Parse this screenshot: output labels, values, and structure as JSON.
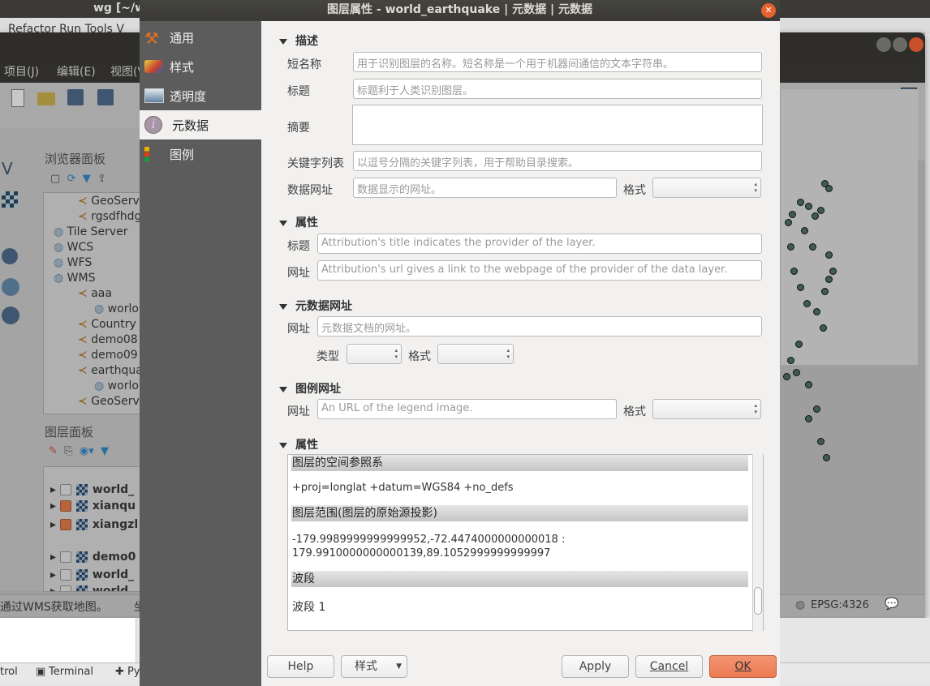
{
  "background": {
    "window_title": "wg [~/w",
    "ide_menu": "Refactor  Run  Tools  V",
    "qgis_menu": [
      "项目(J)",
      "编辑(E)",
      "视图(V"
    ],
    "browser_panel": {
      "title": "浏览器面板",
      "items": [
        {
          "label": "GeoServ",
          "indent": 2
        },
        {
          "label": "rgsdfhdg",
          "indent": 2
        },
        {
          "label": "Tile Server",
          "indent": 1
        },
        {
          "label": "WCS",
          "indent": 1
        },
        {
          "label": "WFS",
          "indent": 1
        },
        {
          "label": "WMS",
          "indent": 1
        },
        {
          "label": "aaa",
          "indent": 2
        },
        {
          "label": "worlo",
          "indent": 3
        },
        {
          "label": "Country",
          "indent": 2
        },
        {
          "label": "demo08",
          "indent": 2
        },
        {
          "label": "demo09",
          "indent": 2
        },
        {
          "label": "earthqua",
          "indent": 2
        },
        {
          "label": "worlo",
          "indent": 3
        },
        {
          "label": "GeoServ",
          "indent": 2
        }
      ]
    },
    "layers_panel": {
      "title": "图层面板",
      "layers": [
        {
          "label": "world_",
          "checked": false
        },
        {
          "label": "xianqu",
          "checked": true
        },
        {
          "label": "xiangzl",
          "checked": true
        },
        {
          "label": "demo0",
          "checked": false
        },
        {
          "label": "world_",
          "checked": false
        },
        {
          "label": "world",
          "checked": false
        }
      ]
    },
    "status_message": "通过WMS获取地图。",
    "status_coord_label": "坐",
    "crs": "EPSG:4326",
    "ide_tabs": [
      "trol",
      "Terminal",
      "Py"
    ]
  },
  "dialog": {
    "title": "图层属性 - world_earthquake | 元数据 | 元数据",
    "sidebar": [
      {
        "label": "通用",
        "icon": "tools-icon"
      },
      {
        "label": "样式",
        "icon": "paintbrush-icon"
      },
      {
        "label": "透明度",
        "icon": "transparency-icon"
      },
      {
        "label": "元数据",
        "icon": "info-icon",
        "selected": true
      },
      {
        "label": "图例",
        "icon": "legend-icon"
      }
    ],
    "description": {
      "header": "描述",
      "short_name_label": "短名称",
      "short_name_placeholder": "用于识别图层的名称。短名称是一个用于机器间通信的文本字符串。",
      "title_label": "标题",
      "title_placeholder": "标题利于人类识别图层。",
      "abstract_label": "摘要",
      "keywords_label": "关键字列表",
      "keywords_placeholder": "以逗号分隔的关键字列表，用于帮助目录搜索。",
      "data_url_label": "数据网址",
      "data_url_placeholder": "数据显示的网址。",
      "format_label": "格式"
    },
    "attribution": {
      "header": "属性",
      "title_label": "标题",
      "title_placeholder": "Attribution's title indicates the provider of the layer.",
      "url_label": "网址",
      "url_placeholder": "Attribution's url gives a link to the webpage of the provider of the data layer."
    },
    "metadata_url": {
      "header": "元数据网址",
      "url_label": "网址",
      "url_placeholder": "元数据文档的网址。",
      "type_label": "类型",
      "format_label": "格式"
    },
    "legend_url": {
      "header": "图例网址",
      "url_label": "网址",
      "url_placeholder": "An URL of the legend image.",
      "format_label": "格式"
    },
    "properties": {
      "header": "属性",
      "crs_header": "图层的空间参照系",
      "crs_value": "+proj=longlat +datum=WGS84 +no_defs",
      "extent_header": "图层范围(图层的原始源投影)",
      "extent_line1": "-179.9989999999999952,-72.4474000000000018 :",
      "extent_line2": "179.9910000000000139,89.1052999999999997",
      "bands_header": "波段",
      "band1": "波段 1"
    },
    "buttons": {
      "help": "Help",
      "style": "样式",
      "apply": "Apply",
      "cancel": "Cancel",
      "ok": "OK"
    },
    "accent_color": "#ec7a53"
  }
}
